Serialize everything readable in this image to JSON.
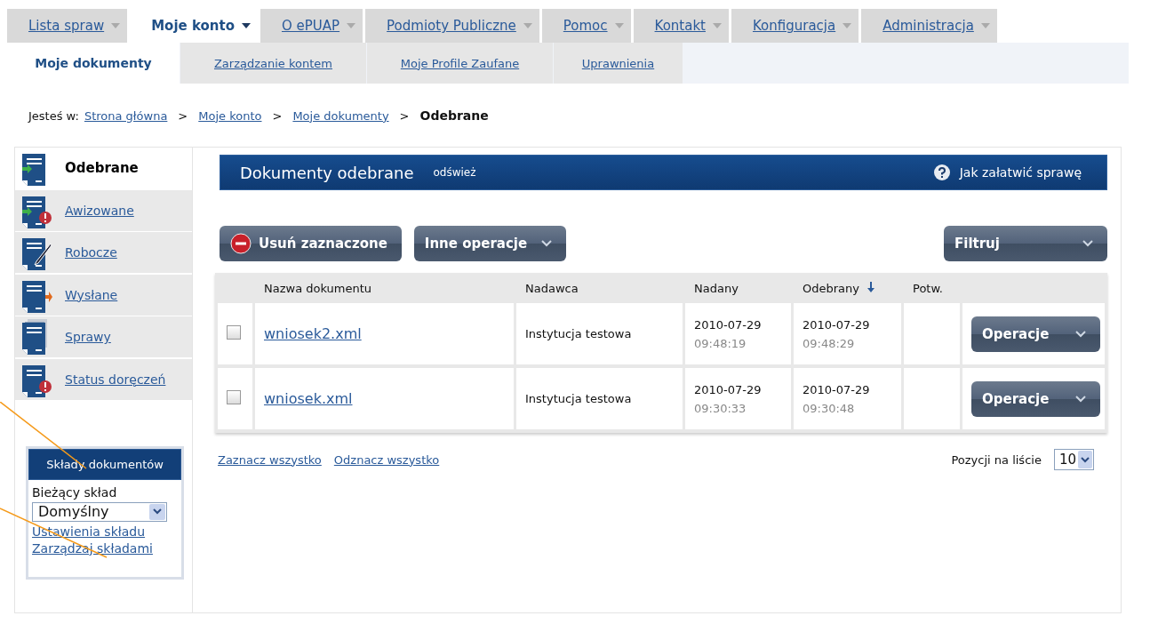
{
  "nav": {
    "tabs": [
      {
        "label": "Lista spraw",
        "selected": false
      },
      {
        "label": "Moje konto",
        "selected": true
      },
      {
        "label": "O ePUAP",
        "selected": false
      },
      {
        "label": "Podmioty Publiczne",
        "selected": false
      },
      {
        "label": "Pomoc",
        "selected": false
      },
      {
        "label": "Kontakt",
        "selected": false
      },
      {
        "label": "Konfiguracja",
        "selected": false
      },
      {
        "label": "Administracja",
        "selected": false
      }
    ]
  },
  "subnav": {
    "tabs": [
      {
        "label": "Moje dokumenty",
        "selected": true
      },
      {
        "label": "Zarządzanie kontem",
        "selected": false
      },
      {
        "label": "Moje Profile Zaufane",
        "selected": false
      },
      {
        "label": "Uprawnienia",
        "selected": false
      }
    ]
  },
  "breadcrumb": {
    "prefix": "Jesteś w:",
    "links": [
      "Strona główna",
      "Moje konto",
      "Moje dokumenty"
    ],
    "separators": [
      ">",
      ">",
      ">"
    ],
    "current": "Odebrane"
  },
  "sidebar": {
    "items": [
      {
        "label": "Odebrane",
        "selected": true
      },
      {
        "label": "Awizowane",
        "selected": false
      },
      {
        "label": "Robocze",
        "selected": false
      },
      {
        "label": "Wysłane",
        "selected": false
      },
      {
        "label": "Sprawy",
        "selected": false
      },
      {
        "label": "Status doręczeń",
        "selected": false
      }
    ],
    "panel": {
      "title": "Składy dokumentów",
      "label": "Bieżący skład",
      "select_value": "Domyślny",
      "links": [
        "Ustawienia składu",
        "Zarządzaj składami"
      ]
    }
  },
  "header": {
    "title": "Dokumenty odebrane",
    "refresh": "odśwież",
    "help": "Jak załatwić sprawę"
  },
  "toolbar": {
    "delete": "Usuń zaznaczone",
    "other": "Inne operacje",
    "filter": "Filtruj"
  },
  "table": {
    "columns": [
      {
        "label": "Nazwa dokumentu",
        "sorted": false
      },
      {
        "label": "Nadawca",
        "sorted": false
      },
      {
        "label": "Nadany",
        "sorted": false
      },
      {
        "label": "Odebrany",
        "sorted": true
      },
      {
        "label": "Potw.",
        "sorted": false
      }
    ],
    "rows": [
      {
        "checked": false,
        "name": "wniosek2.xml",
        "sender": "Instytucja testowa",
        "sent_date": "2010-07-29",
        "sent_time": "09:48:19",
        "received_date": "2010-07-29",
        "received_time": "09:48:29",
        "action": "Operacje"
      },
      {
        "checked": false,
        "name": "wniosek.xml",
        "sender": "Instytucja testowa",
        "sent_date": "2010-07-29",
        "sent_time": "09:30:33",
        "received_date": "2010-07-29",
        "received_time": "09:30:48",
        "action": "Operacje"
      }
    ]
  },
  "footer": {
    "select_all": "Zaznacz wszystko",
    "deselect_all": "Odznacz wszystko",
    "page_size_label": "Pozycji na liście",
    "page_size": "10"
  }
}
